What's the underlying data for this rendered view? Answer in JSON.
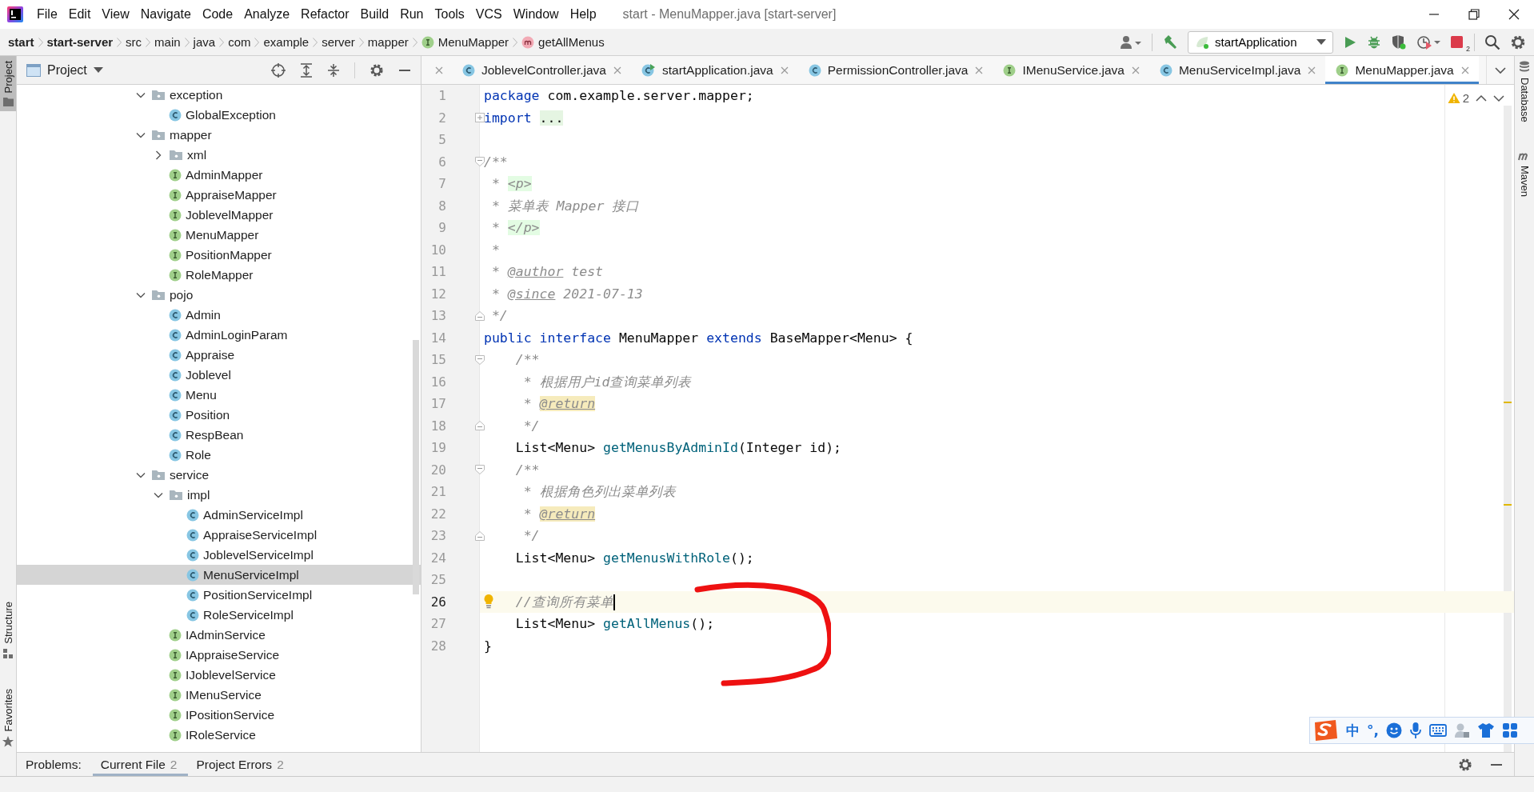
{
  "title_bar": {
    "menu": [
      "File",
      "Edit",
      "View",
      "Navigate",
      "Code",
      "Analyze",
      "Refactor",
      "Build",
      "Run",
      "Tools",
      "VCS",
      "Window",
      "Help"
    ],
    "title": "start - MenuMapper.java [start-server]"
  },
  "nav_bar": {
    "breadcrumbs": [
      {
        "label": "start",
        "kind": "module"
      },
      {
        "label": "start-server",
        "kind": "module"
      },
      {
        "label": "src",
        "kind": "folder"
      },
      {
        "label": "main",
        "kind": "folder"
      },
      {
        "label": "java",
        "kind": "folder"
      },
      {
        "label": "com",
        "kind": "folder"
      },
      {
        "label": "example",
        "kind": "folder"
      },
      {
        "label": "server",
        "kind": "folder"
      },
      {
        "label": "mapper",
        "kind": "folder"
      },
      {
        "label": "MenuMapper",
        "kind": "interface"
      },
      {
        "label": "getAllMenus",
        "kind": "method"
      }
    ],
    "run_config": "startApplication",
    "stop_badge": "2"
  },
  "left_stripe": {
    "top": [
      {
        "label": "Project",
        "kind": "project",
        "selected": true
      }
    ],
    "bottom": [
      {
        "label": "Structure",
        "kind": "structure",
        "selected": false
      },
      {
        "label": "Favorites",
        "kind": "favorites",
        "selected": false
      }
    ]
  },
  "project_panel": {
    "title": "Project",
    "tree": [
      {
        "label": "exception",
        "kind": "folder",
        "expanded": true,
        "selected": false,
        "children": [
          {
            "label": "GlobalException",
            "kind": "class",
            "selected": false
          }
        ]
      },
      {
        "label": "mapper",
        "kind": "folder",
        "expanded": true,
        "selected": false,
        "children": [
          {
            "label": "xml",
            "kind": "folder",
            "expanded": false,
            "selected": false
          },
          {
            "label": "AdminMapper",
            "kind": "interface",
            "selected": false
          },
          {
            "label": "AppraiseMapper",
            "kind": "interface",
            "selected": false
          },
          {
            "label": "JoblevelMapper",
            "kind": "interface",
            "selected": false
          },
          {
            "label": "MenuMapper",
            "kind": "interface",
            "selected": false
          },
          {
            "label": "PositionMapper",
            "kind": "interface",
            "selected": false
          },
          {
            "label": "RoleMapper",
            "kind": "interface",
            "selected": false
          }
        ]
      },
      {
        "label": "pojo",
        "kind": "folder",
        "expanded": true,
        "selected": false,
        "children": [
          {
            "label": "Admin",
            "kind": "class",
            "selected": false
          },
          {
            "label": "AdminLoginParam",
            "kind": "class",
            "selected": false
          },
          {
            "label": "Appraise",
            "kind": "class",
            "selected": false
          },
          {
            "label": "Joblevel",
            "kind": "class",
            "selected": false
          },
          {
            "label": "Menu",
            "kind": "class",
            "selected": false
          },
          {
            "label": "Position",
            "kind": "class",
            "selected": false
          },
          {
            "label": "RespBean",
            "kind": "class",
            "selected": false
          },
          {
            "label": "Role",
            "kind": "class",
            "selected": false
          }
        ]
      },
      {
        "label": "service",
        "kind": "folder",
        "expanded": true,
        "selected": false,
        "children": [
          {
            "label": "impl",
            "kind": "folder",
            "expanded": true,
            "selected": false,
            "children": [
              {
                "label": "AdminServiceImpl",
                "kind": "class",
                "selected": false
              },
              {
                "label": "AppraiseServiceImpl",
                "kind": "class",
                "selected": false
              },
              {
                "label": "JoblevelServiceImpl",
                "kind": "class",
                "selected": false
              },
              {
                "label": "MenuServiceImpl",
                "kind": "class",
                "selected": true
              },
              {
                "label": "PositionServiceImpl",
                "kind": "class",
                "selected": false
              },
              {
                "label": "RoleServiceImpl",
                "kind": "class",
                "selected": false
              }
            ]
          },
          {
            "label": "IAdminService",
            "kind": "interface",
            "selected": false
          },
          {
            "label": "IAppraiseService",
            "kind": "interface",
            "selected": false
          },
          {
            "label": "IJoblevelService",
            "kind": "interface",
            "selected": false
          },
          {
            "label": "IMenuService",
            "kind": "interface",
            "selected": false
          },
          {
            "label": "IPositionService",
            "kind": "interface",
            "selected": false
          },
          {
            "label": "IRoleService",
            "kind": "interface",
            "selected": false
          }
        ]
      }
    ]
  },
  "editor": {
    "tabs": [
      {
        "label": "JoblevelController.java",
        "kind": "class",
        "selected": false
      },
      {
        "label": "startApplication.java",
        "kind": "run_class",
        "selected": false
      },
      {
        "label": "PermissionController.java",
        "kind": "class",
        "selected": false
      },
      {
        "label": "IMenuService.java",
        "kind": "interface",
        "selected": false
      },
      {
        "label": "MenuServiceImpl.java",
        "kind": "class",
        "selected": false
      },
      {
        "label": "MenuMapper.java",
        "kind": "interface",
        "selected": true
      }
    ],
    "warning_count": "2",
    "lines": [
      {
        "number": "1",
        "current": false,
        "tokens": [
          {
            "kind": "keyword",
            "text": "package"
          },
          {
            "kind": "plain",
            "text": " com.example.server.mapper;"
          }
        ]
      },
      {
        "number": "2",
        "current": false,
        "fold": {
          "kind": "expand"
        },
        "tokens": [
          {
            "kind": "keyword",
            "text": "import"
          },
          {
            "kind": "folded",
            "text": "..."
          }
        ]
      },
      {
        "number": "5",
        "current": false
      },
      {
        "number": "6",
        "current": false,
        "fold": {
          "kind": "start"
        },
        "tokens": [
          {
            "kind": "comment",
            "text": "/**"
          }
        ]
      },
      {
        "number": "7",
        "current": false,
        "tokens": [
          {
            "kind": "comment",
            "text": " * "
          },
          {
            "kind": "html_tag",
            "text": "<p>"
          }
        ]
      },
      {
        "number": "8",
        "current": false,
        "tokens": [
          {
            "kind": "comment",
            "text": " * 菜单表 Mapper 接口"
          }
        ]
      },
      {
        "number": "9",
        "current": false,
        "tokens": [
          {
            "kind": "comment",
            "text": " * "
          },
          {
            "kind": "html_tag",
            "text": "</p>"
          }
        ]
      },
      {
        "number": "10",
        "current": false,
        "tokens": [
          {
            "kind": "comment",
            "text": " *"
          }
        ]
      },
      {
        "number": "11",
        "current": false,
        "tokens": [
          {
            "kind": "comment",
            "text": " * "
          },
          {
            "kind": "doc_tag",
            "text": "@author"
          },
          {
            "kind": "comment",
            "text": " test"
          }
        ]
      },
      {
        "number": "12",
        "current": false,
        "tokens": [
          {
            "kind": "comment",
            "text": " * "
          },
          {
            "kind": "doc_tag",
            "text": "@since"
          },
          {
            "kind": "comment",
            "text": " 2021-07-13"
          }
        ]
      },
      {
        "number": "13",
        "current": false,
        "fold": {
          "kind": "end"
        },
        "tokens": [
          {
            "kind": "comment",
            "text": " */"
          }
        ]
      },
      {
        "number": "14",
        "current": false,
        "tokens": [
          {
            "kind": "keyword",
            "text": "public interface"
          },
          {
            "kind": "plain",
            "text": " MenuMapper "
          },
          {
            "kind": "keyword",
            "text": "extends"
          },
          {
            "kind": "plain",
            "text": " BaseMapper<Menu> {"
          }
        ]
      },
      {
        "number": "15",
        "current": false,
        "fold": {
          "kind": "start"
        },
        "tokens": [
          {
            "kind": "comment",
            "text": "    /**"
          }
        ]
      },
      {
        "number": "16",
        "current": false,
        "tokens": [
          {
            "kind": "comment",
            "text": "     * 根据用户id查询菜单列表"
          }
        ]
      },
      {
        "number": "17",
        "current": false,
        "tokens": [
          {
            "kind": "comment",
            "text": "     * "
          },
          {
            "kind": "doc_tag_warning",
            "text": "@return"
          }
        ]
      },
      {
        "number": "18",
        "current": false,
        "fold": {
          "kind": "end"
        },
        "tokens": [
          {
            "kind": "comment",
            "text": "     */"
          }
        ]
      },
      {
        "number": "19",
        "current": false,
        "tokens": [
          {
            "kind": "plain",
            "text": "    List<Menu> "
          },
          {
            "kind": "method",
            "text": "getMenusByAdminId"
          },
          {
            "kind": "plain",
            "text": "(Integer id);"
          }
        ]
      },
      {
        "number": "20",
        "current": false,
        "fold": {
          "kind": "start"
        },
        "tokens": [
          {
            "kind": "comment",
            "text": "    /**"
          }
        ]
      },
      {
        "number": "21",
        "current": false,
        "tokens": [
          {
            "kind": "comment",
            "text": "     * 根据角色列出菜单列表"
          }
        ]
      },
      {
        "number": "22",
        "current": false,
        "tokens": [
          {
            "kind": "comment",
            "text": "     * "
          },
          {
            "kind": "doc_tag_warning",
            "text": "@return"
          }
        ]
      },
      {
        "number": "23",
        "current": false,
        "fold": {
          "kind": "end"
        },
        "tokens": [
          {
            "kind": "comment",
            "text": "     */"
          }
        ]
      },
      {
        "number": "24",
        "current": false,
        "tokens": [
          {
            "kind": "plain",
            "text": "    List<Menu> "
          },
          {
            "kind": "method",
            "text": "getMenusWithRole"
          },
          {
            "kind": "plain",
            "text": "();"
          }
        ]
      },
      {
        "number": "25",
        "current": false
      },
      {
        "number": "26",
        "current": true,
        "tokens": [
          {
            "kind": "comment",
            "text": "    //查询所有菜单"
          }
        ]
      },
      {
        "number": "27",
        "current": false,
        "tokens": [
          {
            "kind": "plain",
            "text": "    List<Menu> "
          },
          {
            "kind": "method",
            "text": "getAllMenus"
          },
          {
            "kind": "plain",
            "text": "();"
          }
        ]
      },
      {
        "number": "28",
        "current": false,
        "tokens": [
          {
            "kind": "plain",
            "text": "}"
          }
        ]
      }
    ]
  },
  "problems": {
    "title": "Problems:",
    "tabs": [
      {
        "label": "Current File",
        "count": "2",
        "selected": true
      },
      {
        "label": "Project Errors",
        "count": "2",
        "selected": false
      }
    ]
  },
  "right_stripe": [
    {
      "label": "Database",
      "kind": "database"
    },
    {
      "label": "Maven",
      "kind": "maven"
    }
  ],
  "ime_bar": {
    "mode": "中",
    "punctuation": "°,"
  }
}
